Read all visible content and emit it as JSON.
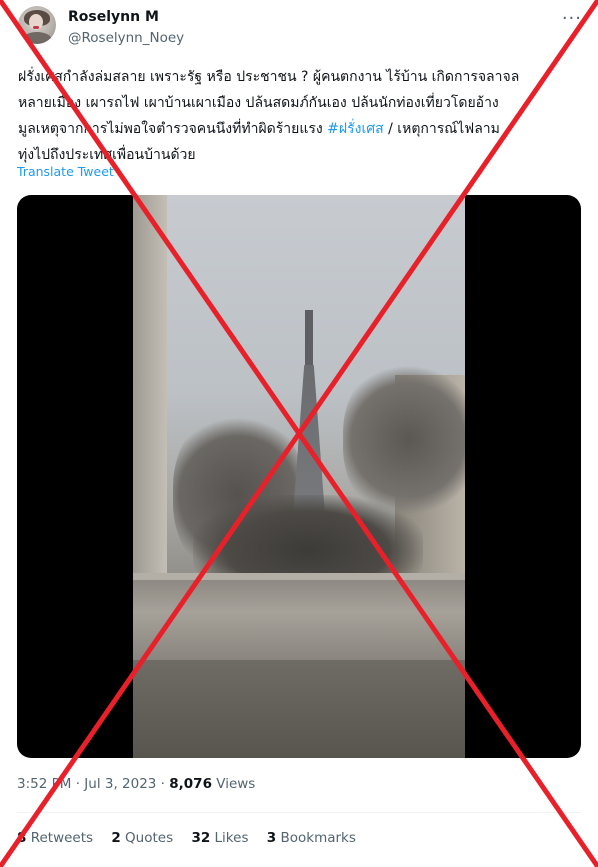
{
  "tweet": {
    "author": {
      "display_name": "Roselynn M",
      "handle": "@Roselynn_Noey",
      "avatar_icon": "profile-photo-avatar"
    },
    "more_icon": "more-options-icon",
    "more_glyph": "···",
    "text_lines": [
      "ฝรั่งเศสกำลังล่มสลาย เพราะรัฐ หรือ ประชาชน ? ผู้คนตกงาน ไร้บ้าน เกิดการจลาจล",
      "หลายเมือง เผารถไฟ เผาบ้านเผาเมือง ปล้นสดมภ์กันเอง ปล้นนักท่องเที่ยวโดยอ้าง",
      "มูลเหตุจากการไม่พอใจตำรวจคนนึงที่ทำผิดร้ายแรง"
    ],
    "hashtag": "#ฝรั่งเศส",
    "text_after_hashtag": " / เหตุการณ์ไฟลาม",
    "text_last_line": "ทุ่งไปถึงประเทศเพื่อนบ้านด้วย",
    "translate_label": "Translate Tweet",
    "media": {
      "type": "video",
      "description_icon": "video-frame-eiffel-tower-smoke"
    },
    "meta": {
      "time": "3:52 PM",
      "separator": " · ",
      "date": "Jul 3, 2023",
      "views_count": "8,076",
      "views_label": " Views"
    },
    "stats": [
      {
        "count": "8",
        "label": " Retweets"
      },
      {
        "count": "2",
        "label": " Quotes"
      },
      {
        "count": "32",
        "label": " Likes"
      },
      {
        "count": "3",
        "label": " Bookmarks"
      }
    ],
    "colors": {
      "accent": "#1d9bf0",
      "secondary_text": "#536471",
      "overlay_cross": "#e8202a"
    }
  }
}
